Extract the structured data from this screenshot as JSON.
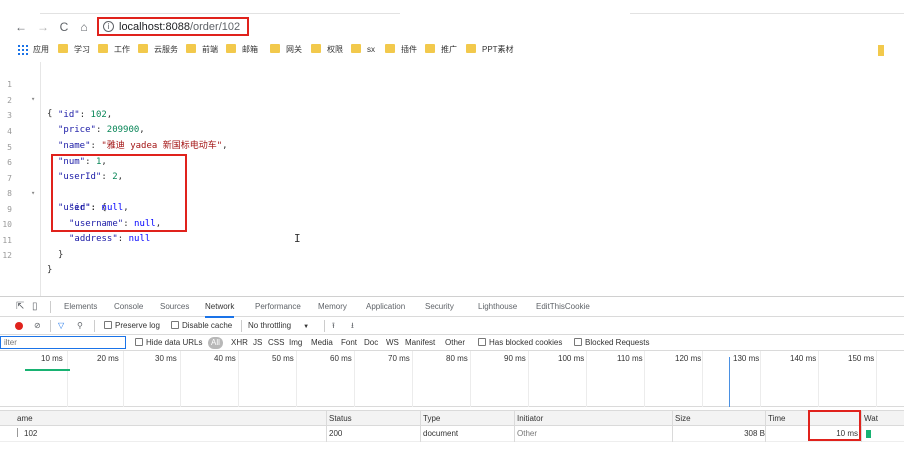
{
  "browser": {
    "nav": {
      "back": "←",
      "forward": "→",
      "reload": "C",
      "home": "⌂"
    },
    "url": {
      "host_port": "localhost:8088",
      "path": "/order/102"
    },
    "bookmarks": {
      "apps_label": "应用",
      "items": [
        "学习",
        "工作",
        "云服务",
        "前端",
        "邮箱",
        "网关",
        "权限",
        "sx",
        "插件",
        "推广",
        "PPT素材"
      ]
    }
  },
  "json_viewer": {
    "line_numbers": [
      "1",
      "2",
      "3",
      "4",
      "5",
      "6",
      "7",
      "8",
      "9",
      "10",
      "11",
      "12"
    ],
    "fold_marker": "▾",
    "lines": [
      {
        "indent": "",
        "key": "",
        "value": "",
        "suffix": "{"
      },
      {
        "indent": "  ",
        "key": "\"id\"",
        "value": "102",
        "type": "n",
        "suffix": ","
      },
      {
        "indent": "  ",
        "key": "\"price\"",
        "value": "209900",
        "type": "n",
        "suffix": ","
      },
      {
        "indent": "  ",
        "key": "\"name\"",
        "value": "\"雅迪 yadea 新国标电动车\"",
        "type": "s",
        "suffix": ","
      },
      {
        "indent": "  ",
        "key": "\"num\"",
        "value": "1",
        "type": "n",
        "suffix": ","
      },
      {
        "indent": "  ",
        "key": "\"userId\"",
        "value": "2",
        "type": "n",
        "suffix": ","
      },
      {
        "indent": "  ",
        "key": "\"user\"",
        "value": "",
        "type": "p",
        "suffix": "{"
      },
      {
        "indent": "    ",
        "key": "\"id\"",
        "value": "null",
        "type": "kw",
        "suffix": ","
      },
      {
        "indent": "    ",
        "key": "\"username\"",
        "value": "null",
        "type": "kw",
        "suffix": ","
      },
      {
        "indent": "    ",
        "key": "\"address\"",
        "value": "null",
        "type": "kw",
        "suffix": ""
      },
      {
        "indent": "  ",
        "key": "",
        "value": "",
        "suffix": "}"
      },
      {
        "indent": "",
        "key": "",
        "value": "",
        "suffix": "}"
      }
    ],
    "cursor": "I"
  },
  "devtools": {
    "tabs": [
      "Elements",
      "Console",
      "Sources",
      "Network",
      "Performance",
      "Memory",
      "Application",
      "Security",
      "Lighthouse",
      "EditThisCookie"
    ],
    "active_tab": "Network",
    "toolbar": {
      "preserve_log": "Preserve log",
      "disable_cache": "Disable cache",
      "throttling": "No throttling",
      "throttling_caret": "▼"
    },
    "filter": {
      "placeholder": "ilter",
      "hide_data_urls": "Hide data URLs",
      "types": [
        "All",
        "XHR",
        "JS",
        "CSS",
        "Img",
        "Media",
        "Font",
        "Doc",
        "WS",
        "Manifest",
        "Other"
      ],
      "has_blocked_cookies": "Has blocked cookies",
      "blocked_requests": "Blocked Requests"
    },
    "timeline_ticks": [
      "10 ms",
      "20 ms",
      "30 ms",
      "40 ms",
      "50 ms",
      "60 ms",
      "70 ms",
      "80 ms",
      "90 ms",
      "100 ms",
      "110 ms",
      "120 ms",
      "130 ms",
      "140 ms",
      "150 ms"
    ],
    "table": {
      "headers": {
        "name": "ame",
        "status": "Status",
        "type": "Type",
        "initiator": "Initiator",
        "size": "Size",
        "time": "Time",
        "waterfall": "Wat"
      },
      "rows": [
        {
          "name": "102",
          "status": "200",
          "type": "document",
          "initiator": "Other",
          "size": "308 B",
          "time": "10 ms"
        }
      ]
    },
    "colors": {
      "accent": "#1a73e8",
      "highlight": "#e0221c",
      "waterfall": "#18b272"
    }
  }
}
